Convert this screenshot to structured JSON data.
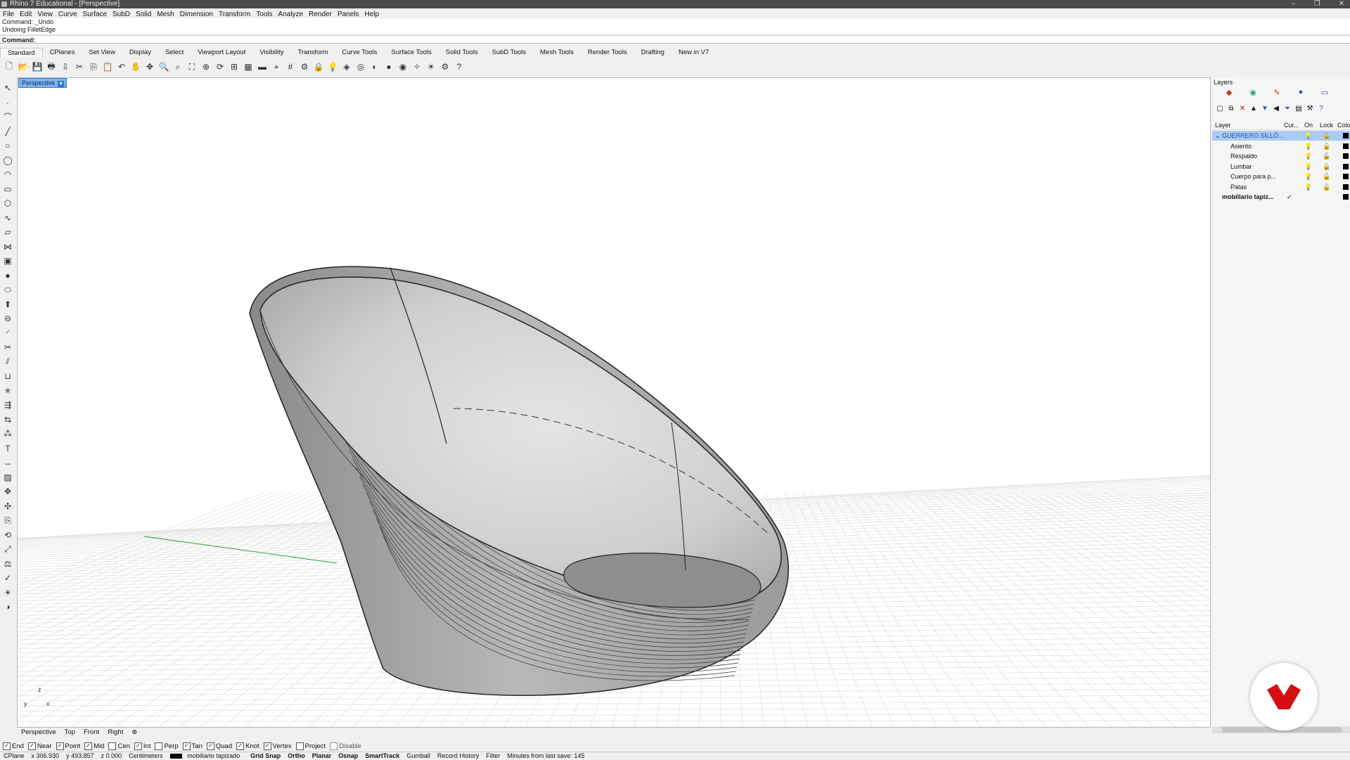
{
  "window": {
    "title": "Rhino 7 Educational - [Perspective]",
    "controls": [
      "–",
      "❐",
      "✕"
    ]
  },
  "menu": [
    "File",
    "Edit",
    "View",
    "Curve",
    "Surface",
    "SubD",
    "Solid",
    "Mesh",
    "Dimension",
    "Transform",
    "Tools",
    "Analyze",
    "Render",
    "Panels",
    "Help"
  ],
  "command_history": [
    "Command: _Undo",
    "Undoing FilletEdge"
  ],
  "command_prompt": "Command:",
  "toolbar_tabs": [
    "Standard",
    "CPlanes",
    "Set View",
    "Display",
    "Select",
    "Viewport Layout",
    "Visibility",
    "Transform",
    "Curve Tools",
    "Surface Tools",
    "Solid Tools",
    "SubD Tools",
    "Mesh Tools",
    "Render Tools",
    "Drafting",
    "New in V7"
  ],
  "toolbar_icons": [
    "new-file-icon",
    "open-icon",
    "save-icon",
    "print-icon",
    "import-icon",
    "cut-icon",
    "copy-icon",
    "paste-icon",
    "undo-icon",
    "pan-icon",
    "move-view-icon",
    "zoom-icon",
    "zoom-window-icon",
    "zoom-extents-icon",
    "zoom-selected-icon",
    "rotate-view-icon",
    "four-viewports-icon",
    "cplane-icon",
    "set-cplane-icon",
    "object-snap-icon",
    "grid-icon",
    "properties-icon",
    "lock-icon",
    "lights-icon",
    "layers-icon",
    "color-icon",
    "wireframe-icon",
    "shaded-icon",
    "rendered-icon",
    "material-icon",
    "render-icon",
    "settings-icon",
    "help-icon"
  ],
  "left_tools": [
    "select-icon",
    "point-icon",
    "polyline-icon",
    "line-icon",
    "circle-icon",
    "ellipse-icon",
    "arc-icon",
    "rectangle-icon",
    "polygon-icon",
    "curve-icon",
    "surface-icon",
    "loft-icon",
    "box-icon",
    "sphere-icon",
    "cylinder-icon",
    "extrude-icon",
    "boolean-icon",
    "fillet-icon",
    "trim-icon",
    "split-icon",
    "join-icon",
    "explode-icon",
    "offset-icon",
    "mirror-icon",
    "array-icon",
    "text-icon",
    "dimension-icon",
    "hatch-icon",
    "gumball-icon",
    "move-icon",
    "copy-tool-icon",
    "rotate-icon",
    "scale-icon",
    "analyze-icon",
    "check-icon",
    "render-tool-icon",
    "shade-icon"
  ],
  "viewport": {
    "active_tab": "Perspective",
    "tabs": [
      "Perspective",
      "Top",
      "Front",
      "Right"
    ],
    "axis_labels": [
      "z",
      "y",
      "x"
    ]
  },
  "layers": {
    "panel_title": "Layers",
    "columns": [
      "Layer",
      "Cur...",
      "On",
      "Lock",
      "Colo"
    ],
    "rows": [
      {
        "name": "GUERRERO SILLÓ...",
        "current": "",
        "selected": true,
        "indent": 0,
        "color": "#000000"
      },
      {
        "name": "Asiento",
        "current": "",
        "selected": false,
        "indent": 1,
        "color": "#000000"
      },
      {
        "name": "Respaldo",
        "current": "",
        "selected": false,
        "indent": 1,
        "color": "#000000"
      },
      {
        "name": "Lumbar",
        "current": "",
        "selected": false,
        "indent": 1,
        "color": "#000000"
      },
      {
        "name": "Cuerpo para p...",
        "current": "",
        "selected": false,
        "indent": 1,
        "color": "#000000"
      },
      {
        "name": "Patas",
        "current": "",
        "selected": false,
        "indent": 1,
        "color": "#000000"
      },
      {
        "name": "mobiliario tapiz...",
        "current": "✓",
        "selected": false,
        "indent": 0,
        "bold": true,
        "color": "#000000"
      }
    ]
  },
  "osnaps": [
    {
      "label": "End",
      "checked": true
    },
    {
      "label": "Near",
      "checked": true
    },
    {
      "label": "Point",
      "checked": true
    },
    {
      "label": "Mid",
      "checked": true
    },
    {
      "label": "Cen",
      "checked": false
    },
    {
      "label": "Int",
      "checked": true
    },
    {
      "label": "Perp",
      "checked": false
    },
    {
      "label": "Tan",
      "checked": true
    },
    {
      "label": "Quad",
      "checked": true
    },
    {
      "label": "Knot",
      "checked": true
    },
    {
      "label": "Vertex",
      "checked": true
    },
    {
      "label": "Project",
      "checked": false
    },
    {
      "label": "Disable",
      "checked": false
    }
  ],
  "status": {
    "cplane": "CPlane",
    "x": "x 306.930",
    "y": "y 493.857",
    "z": "z 0.000",
    "units": "Centimeters",
    "layer": "mobiliario tapizado",
    "toggles": [
      "Grid Snap",
      "Ortho",
      "Planar",
      "Osnap",
      "SmartTrack"
    ],
    "others": [
      "Gumball",
      "Record History",
      "Filter"
    ],
    "save_info": "Minutes from last save: 145"
  },
  "colors": {
    "selection": "#aacbf3",
    "viewport_tab": "#7fb2ea",
    "brand": "#d40f14",
    "axis_x": "#c0392b",
    "axis_y": "#2da02d"
  }
}
